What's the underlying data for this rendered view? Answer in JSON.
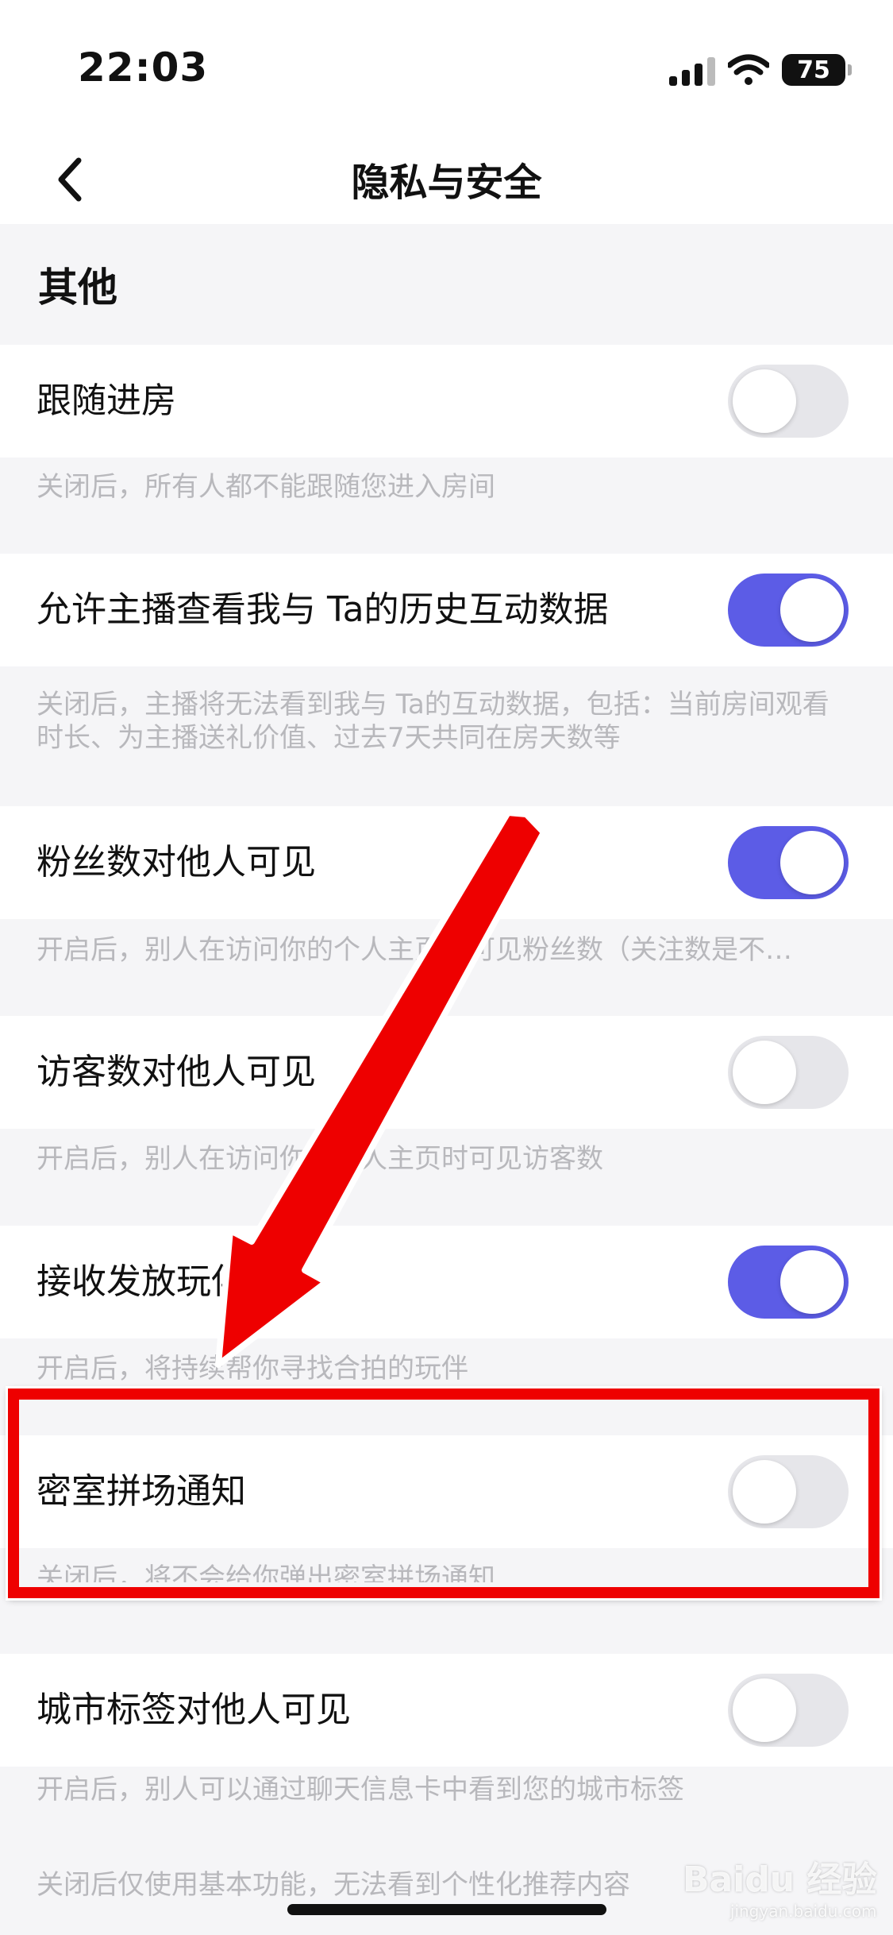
{
  "status_bar": {
    "time": "22:03",
    "battery": "75"
  },
  "nav": {
    "title": "隐私与安全"
  },
  "section": {
    "title": "其他"
  },
  "settings": [
    {
      "label": "跟随进房",
      "on": false,
      "desc": "关闭后，所有人都不能跟随您进入房间"
    },
    {
      "label": "允许主播查看我与 Ta的历史互动数据",
      "on": true,
      "desc": "关闭后，主播将无法看到我与 Ta的互动数据，包括：当前房间观看时长、为主播送礼价值、过去7天共同在房天数等"
    },
    {
      "label": "粉丝数对他人可见",
      "on": true,
      "desc": "开启后，别人在访问你的个人主页时可见粉丝数（关注数是不…"
    },
    {
      "label": "访客数对他人可见",
      "on": false,
      "desc": "开启后，别人在访问你的个人主页时可见访客数"
    },
    {
      "label": "接收发放玩伴",
      "on": true,
      "desc": "开启后，将持续帮你寻找合拍的玩伴"
    },
    {
      "label": "密室拼场通知",
      "on": false,
      "desc": "关闭后，将不会给你弹出密室拼场通知"
    },
    {
      "label": "城市标签对他人可见",
      "on": false,
      "desc": "开启后，别人可以通过聊天信息卡中看到您的城市标签"
    }
  ],
  "footer_note": "关闭后仅使用基本功能，无法看到个性化推荐内容",
  "watermark": {
    "text": "Baidu 经验",
    "sub": "jingyan.baidu.com"
  },
  "colors": {
    "toggle_on": "#5c5ce6",
    "toggle_off": "#e6e6ea",
    "annotation_red": "#ee0000"
  }
}
